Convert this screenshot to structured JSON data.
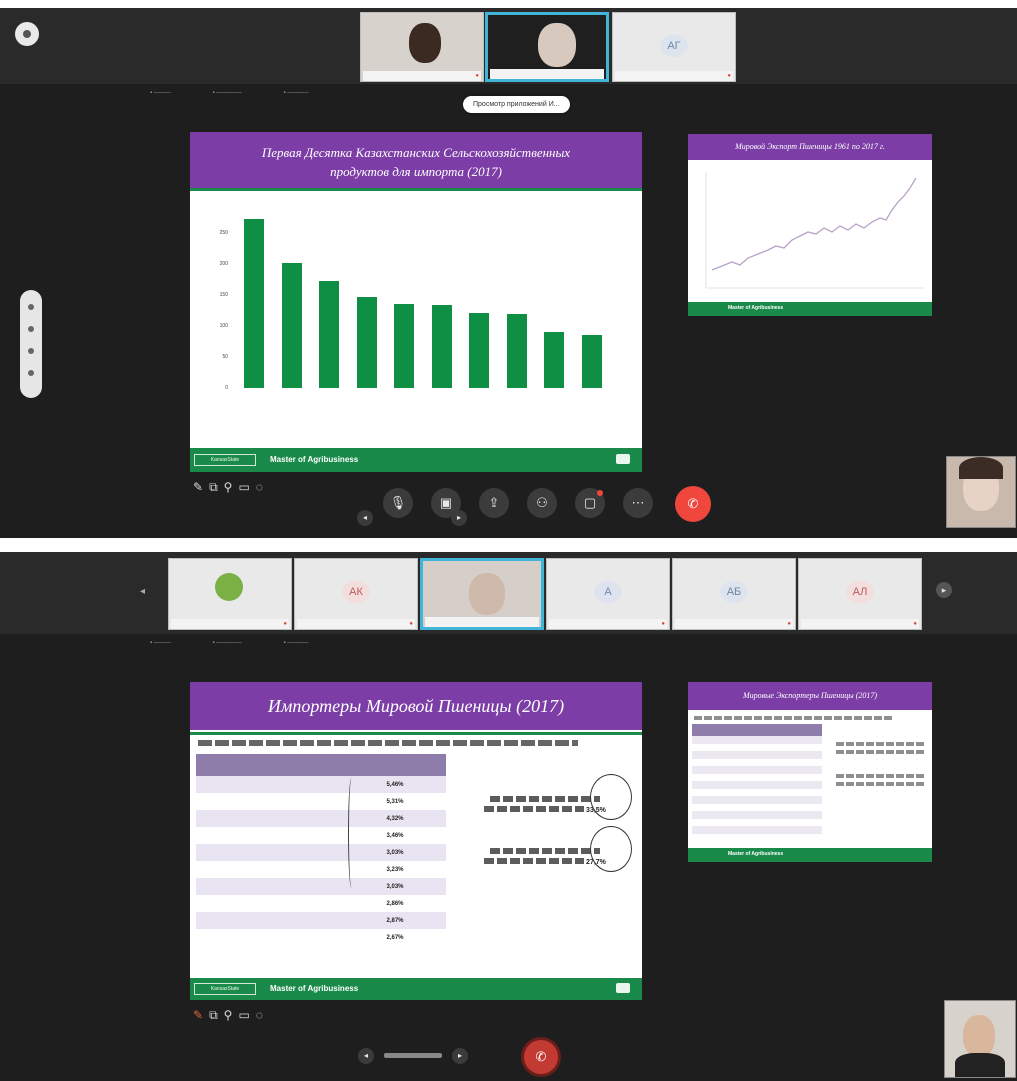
{
  "screen1": {
    "tooltip": "Просмотр приложений И...",
    "pod_caption_left": "",
    "pod_caption_right": "",
    "slide": {
      "title_line1": "Первая Десятка Казахстанских Сельскохозяйственных",
      "title_line2": "продуктов для импорта (2017)",
      "footer_brand": "Master of Agribusiness",
      "footer_logo": "KansasState"
    },
    "side_slide": {
      "title": "Мировой Экспорт Пшеницы 1961 по 2017 г."
    },
    "self_tile_caption": "",
    "colors": {
      "accent_purple": "#7c3ea6",
      "accent_green": "#0e8f43",
      "end_call": "#f0473c",
      "active_border": "#3fb6d8"
    }
  },
  "chart_data": {
    "type": "bar",
    "title": "Первая Десятка Казахстанских Сельскохозяйственных продуктов для импорта (2017)",
    "categories": [
      "",
      "",
      "",
      "",
      "",
      "",
      "",
      "",
      "",
      ""
    ],
    "values": [
      272,
      202,
      172,
      147,
      136,
      134,
      121,
      120,
      90,
      86
    ],
    "ylim": [
      0,
      300
    ],
    "yticks": [
      0,
      50,
      100,
      150,
      200,
      250
    ],
    "grid": false,
    "legend": "none"
  },
  "screen2": {
    "slide": {
      "title": "Импортеры Мировой Пшеницы (2017)",
      "footer_brand": "Master of Agribusiness",
      "footer_logo": "KansasState"
    },
    "table": {
      "header": [
        "",
        ""
      ],
      "rows": [
        [
          "",
          "5,46%"
        ],
        [
          "",
          "5,31%"
        ],
        [
          "",
          "4,32%"
        ],
        [
          "",
          "3,46%"
        ],
        [
          "",
          "3,03%"
        ],
        [
          "",
          "3,23%"
        ],
        [
          "",
          "3,03%"
        ],
        [
          "",
          "2,86%"
        ],
        [
          "",
          "2,87%"
        ],
        [
          "",
          "2,67%"
        ]
      ]
    },
    "note1_value": "33,5%",
    "note2_value": "27,7%",
    "side_slide": {
      "title": "Мировые Экспортеры Пшеницы (2017)"
    }
  }
}
